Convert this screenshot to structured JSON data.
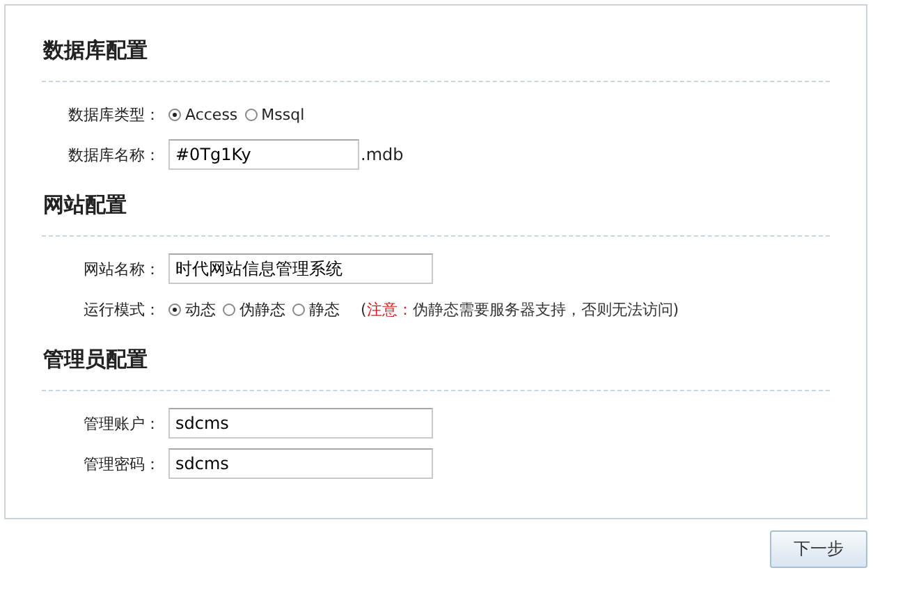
{
  "sections": [
    {
      "title": "数据库配置",
      "fields": [
        {
          "kind": "radio",
          "label": "数据库类型：",
          "options": [
            {
              "label": "Access",
              "selected": true
            },
            {
              "label": "Mssql",
              "selected": false
            }
          ]
        },
        {
          "kind": "text",
          "label": "数据库名称：",
          "value": "#0Tg1Ky",
          "suffix": ".mdb"
        }
      ]
    },
    {
      "title": "网站配置",
      "fields": [
        {
          "kind": "text",
          "label": "网站名称：",
          "value": "时代网站信息管理系统"
        },
        {
          "kind": "radio",
          "label": "运行模式：",
          "options": [
            {
              "label": "动态",
              "selected": true
            },
            {
              "label": "伪静态",
              "selected": false
            },
            {
              "label": "静态",
              "selected": false
            }
          ],
          "note": {
            "open": "(",
            "warning": "注意：",
            "text": "伪静态需要服务器支持，否则无法访问)"
          }
        }
      ]
    },
    {
      "title": "管理员配置",
      "fields": [
        {
          "kind": "text",
          "label": "管理账户：",
          "value": "sdcms"
        },
        {
          "kind": "text",
          "label": "管理密码：",
          "value": "sdcms"
        }
      ]
    }
  ],
  "next_button": "下一步"
}
